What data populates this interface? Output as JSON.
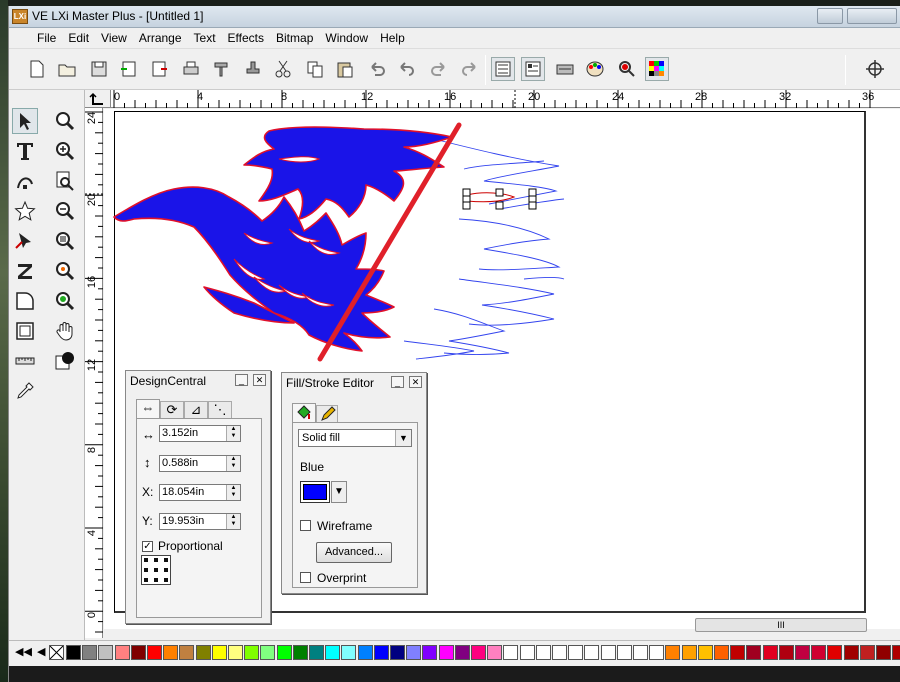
{
  "app": {
    "title": "VE LXi Master Plus - [Untitled 1]",
    "icon_text": "LXi"
  },
  "menu": [
    "File",
    "Edit",
    "View",
    "Arrange",
    "Text",
    "Effects",
    "Bitmap",
    "Window",
    "Help"
  ],
  "toolbar_icons": [
    "new-icon",
    "open-icon",
    "save-icon",
    "import-icon",
    "export-icon",
    "print-icon",
    "plot-icon",
    "stamp-icon",
    "cut-icon",
    "copy-icon",
    "paste-icon",
    "undo-icon",
    "undo-list-icon",
    "redo-icon",
    "redo-list-icon",
    "design-central-icon",
    "object-properties-icon",
    "cutter-icon",
    "color-palette-icon",
    "fill-icon",
    "color-swatch-icon",
    "target-icon"
  ],
  "left_tools": [
    "select-tool-icon",
    "zoom-tool-icon",
    "text-tool-icon",
    "zoom-in-icon",
    "node-edit-icon",
    "zoom-page-icon",
    "star-tool-icon",
    "zoom-out-icon",
    "pen-tool-icon",
    "zoom-fit-icon",
    "z-tool-icon",
    "zoom-selection-icon",
    "shape-tool-icon",
    "zoom-all-icon",
    "rectangle-tool-icon",
    "pan-hand-icon",
    "ruler-tool-icon",
    "fill-tool-icon",
    "eyedropper-icon"
  ],
  "rulers": {
    "horizontal": [
      "0",
      "4",
      "8",
      "12",
      "16",
      "20",
      "24",
      "28",
      "32",
      "36"
    ],
    "vertical": [
      "24",
      "20",
      "16",
      "12",
      "8",
      "4",
      "0"
    ]
  },
  "design_central": {
    "title": "DesignCentral",
    "tab_icons": [
      "move-size-icon",
      "rotate-icon",
      "skew-icon",
      "node-icon"
    ],
    "width_value": "3.152in",
    "height_value": "0.588in",
    "x_label": "X:",
    "x_value": "18.054in",
    "y_label": "Y:",
    "y_value": "19.953in",
    "proportional_label": "Proportional",
    "proportional_checked": true
  },
  "fill_stroke": {
    "title": "Fill/Stroke Editor",
    "tab_icons": [
      "fill-bucket-icon",
      "stroke-pen-icon"
    ],
    "fill_type": "Solid fill",
    "color_name": "Blue",
    "color_hex": "#0000ff",
    "wireframe_label": "Wireframe",
    "wireframe_checked": false,
    "advanced_label": "Advanced...",
    "overprint_label": "Overprint",
    "overprint_checked": false
  },
  "scrollbar_grip": "III",
  "palette_colors": [
    "#000000",
    "#808080",
    "#c0c0c0",
    "#ff8080",
    "#800000",
    "#ff0000",
    "#ff8000",
    "#c08040",
    "#808000",
    "#ffff00",
    "#ffff80",
    "#80ff00",
    "#80ff80",
    "#00ff00",
    "#008000",
    "#008080",
    "#00ffff",
    "#80ffff",
    "#0080ff",
    "#0000ff",
    "#000080",
    "#8080ff",
    "#8000ff",
    "#ff00ff",
    "#800080",
    "#ff0080",
    "#ff80c0",
    "#ffffff",
    "#ffffff",
    "#ffffff",
    "#ffffff",
    "#ffffff",
    "#ffffff",
    "#ffffff",
    "#ffffff",
    "#ffffff",
    "#ffffff",
    "#ff8000",
    "#ffa000",
    "#ffc000",
    "#ff6000",
    "#c00000",
    "#a00020",
    "#e00020",
    "#b00010",
    "#c00040",
    "#d00030",
    "#e00000",
    "#a00000",
    "#c02020",
    "#900000",
    "#b00000"
  ]
}
